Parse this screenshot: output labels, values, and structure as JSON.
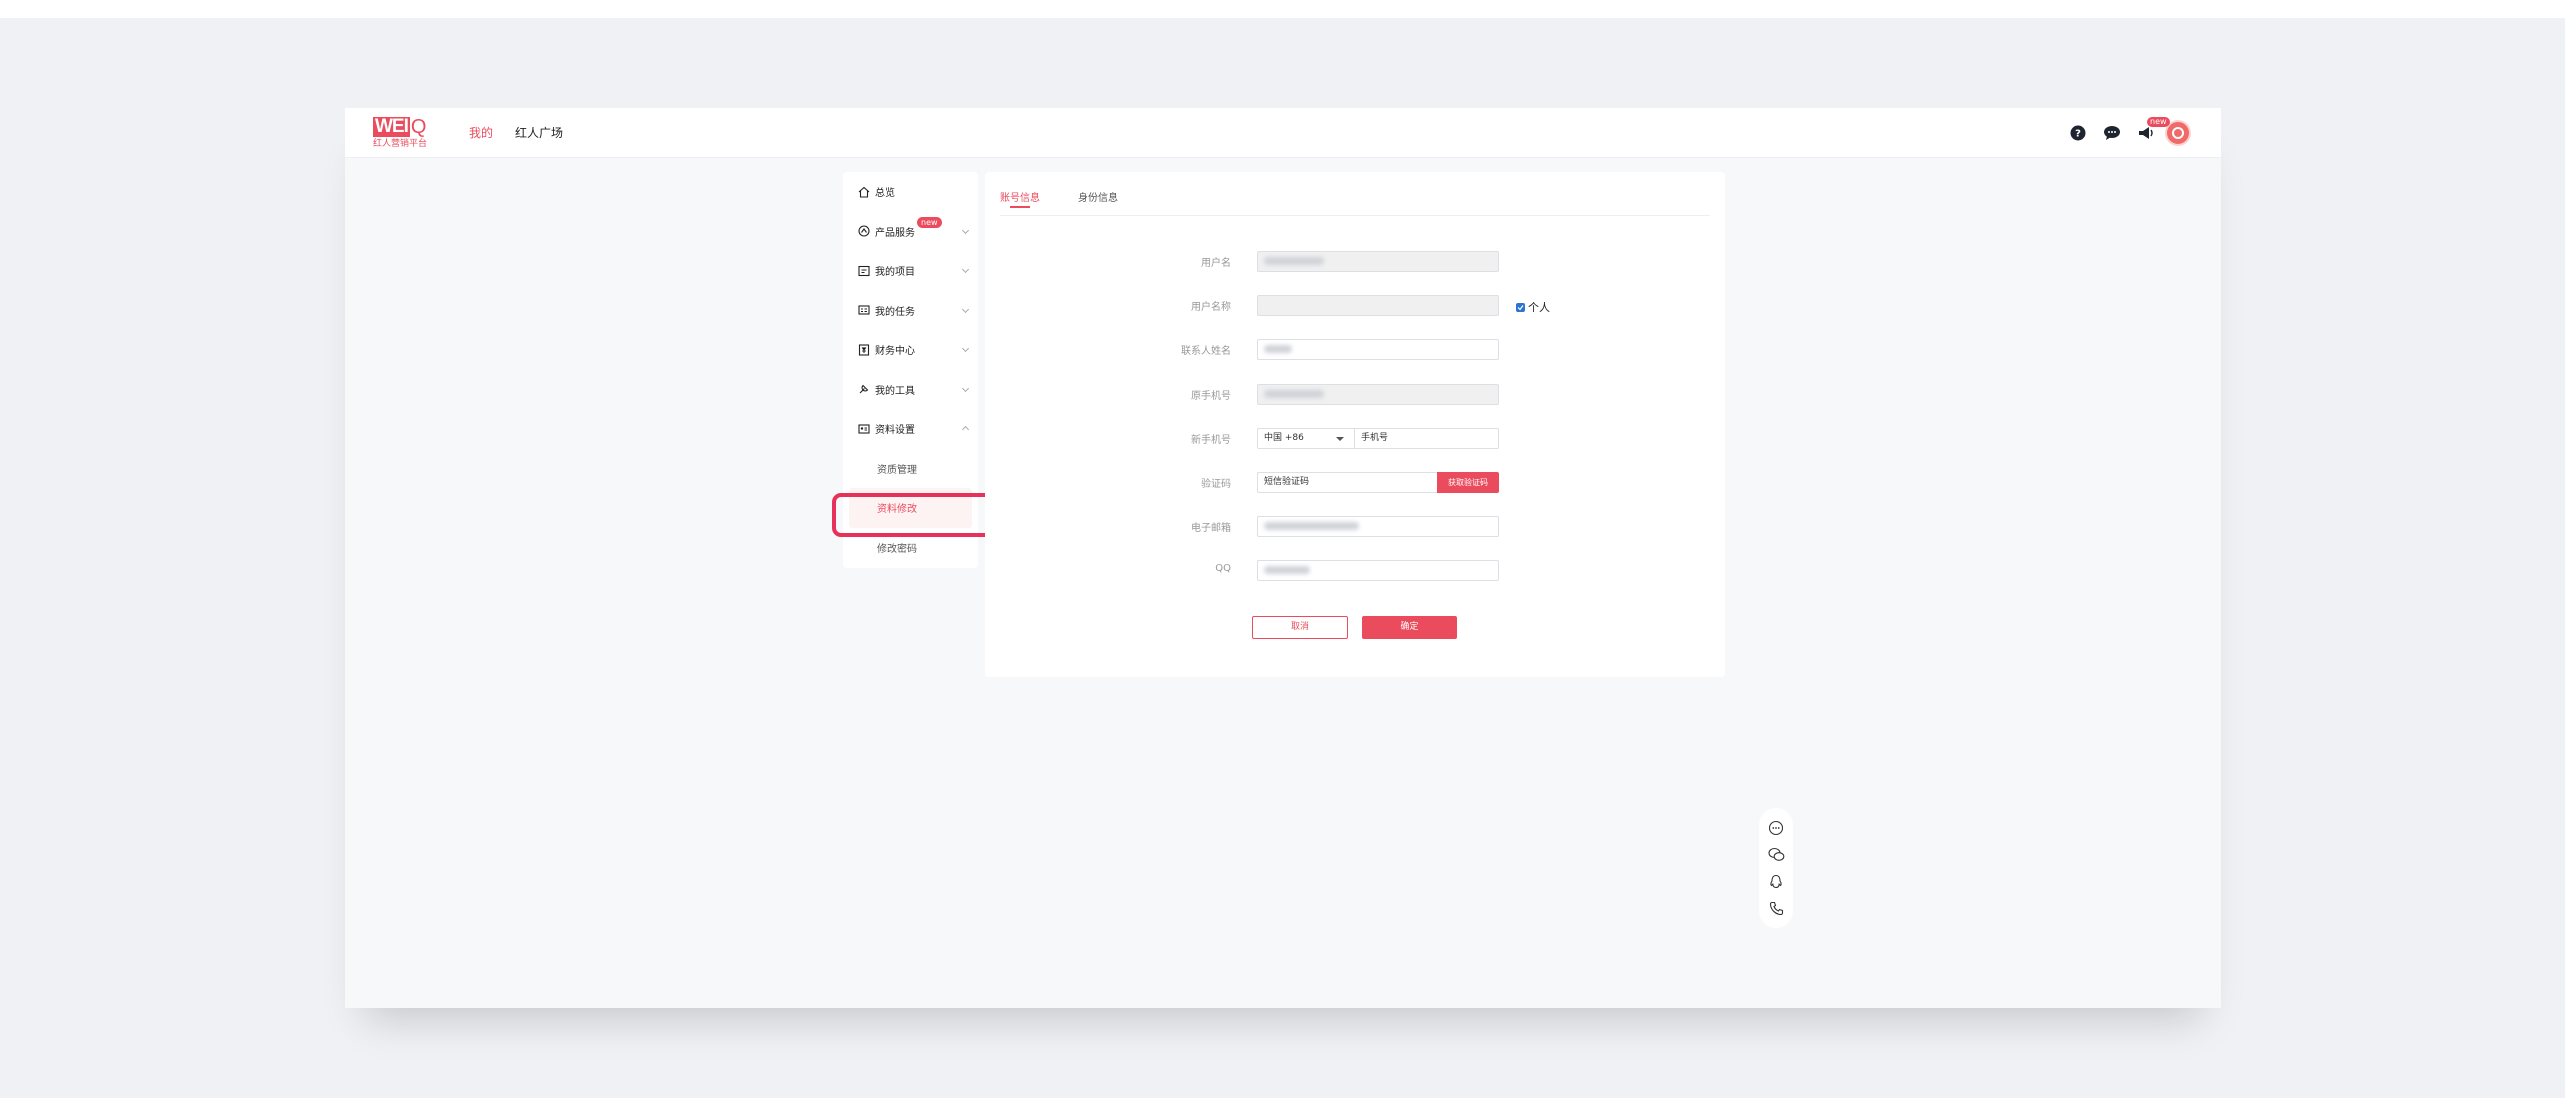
{
  "logo": {
    "brand": "WEI",
    "brand_q": "Q",
    "sub": "红人营销平台"
  },
  "nav": [
    {
      "label": "我的",
      "active": true
    },
    {
      "label": "红人广场",
      "active": false
    }
  ],
  "header": {
    "new_badge": "new"
  },
  "sidebar": {
    "items": [
      {
        "label": "总览",
        "icon": "home-icon"
      },
      {
        "label": "产品服务",
        "icon": "product-icon",
        "badge": "new"
      },
      {
        "label": "我的项目",
        "icon": "project-icon"
      },
      {
        "label": "我的任务",
        "icon": "task-icon"
      },
      {
        "label": "财务中心",
        "icon": "finance-icon"
      },
      {
        "label": "我的工具",
        "icon": "tool-icon"
      },
      {
        "label": "资料设置",
        "icon": "profile-card-icon"
      }
    ],
    "sub_items": [
      {
        "label": "资质管理",
        "active": false
      },
      {
        "label": "资料修改",
        "active": true
      },
      {
        "label": "修改密码",
        "active": false
      }
    ]
  },
  "tabs": [
    {
      "label": "账号信息",
      "active": true
    },
    {
      "label": "身份信息",
      "active": false
    }
  ],
  "form": {
    "username_label": "用户名",
    "display_name_label": "用户名称",
    "personal_label": "个人",
    "contact_label": "联系人姓名",
    "old_phone_label": "原手机号",
    "new_phone_label": "新手机号",
    "country_code": "中国 +86",
    "phone_placeholder": "手机号",
    "code_label": "验证码",
    "code_placeholder": "短信验证码",
    "get_code_button": "获取验证码",
    "email_label": "电子邮箱",
    "qq_label": "QQ",
    "cancel_button": "取消",
    "confirm_button": "确定"
  },
  "colors": {
    "accent": "#ea4c5e",
    "highlight": "#e8315a",
    "checkbox": "#2c73d2"
  }
}
